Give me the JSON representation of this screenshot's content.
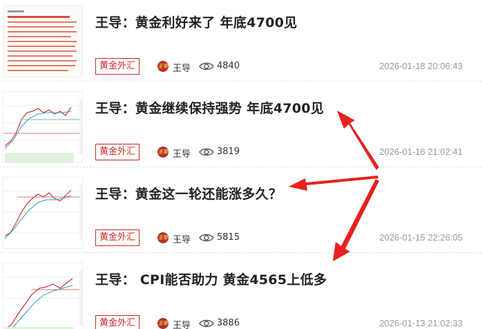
{
  "colors": {
    "accent": "#c8261f",
    "arrow": "#e8211f",
    "muted": "#999999"
  },
  "articles": [
    {
      "title": "王导：黄金利好来了 年底4700见",
      "tag": "黄金外汇",
      "author": "王导",
      "views": "4840",
      "date": "2026-01-18 20:06:43",
      "thumb_icon": "text-article-thumbnail"
    },
    {
      "title": "王导：黄金继续保持强势 年底4700见",
      "tag": "黄金外汇",
      "author": "王导",
      "views": "3819",
      "date": "2026-01-16 21:02:41",
      "thumb_icon": "price-chart-thumbnail"
    },
    {
      "title": "王导：黄金这一轮还能涨多久？",
      "tag": "黄金外汇",
      "author": "王导",
      "views": "5815",
      "date": "2026-01-15 22:26:05",
      "thumb_icon": "price-chart-thumbnail"
    },
    {
      "title": "王导： CPI能否助力 黄金4565上低多",
      "tag": "黄金外汇",
      "author": "王导",
      "views": "3886",
      "date": "2026-01-13 21:02:33",
      "thumb_icon": "price-chart-thumbnail"
    }
  ]
}
